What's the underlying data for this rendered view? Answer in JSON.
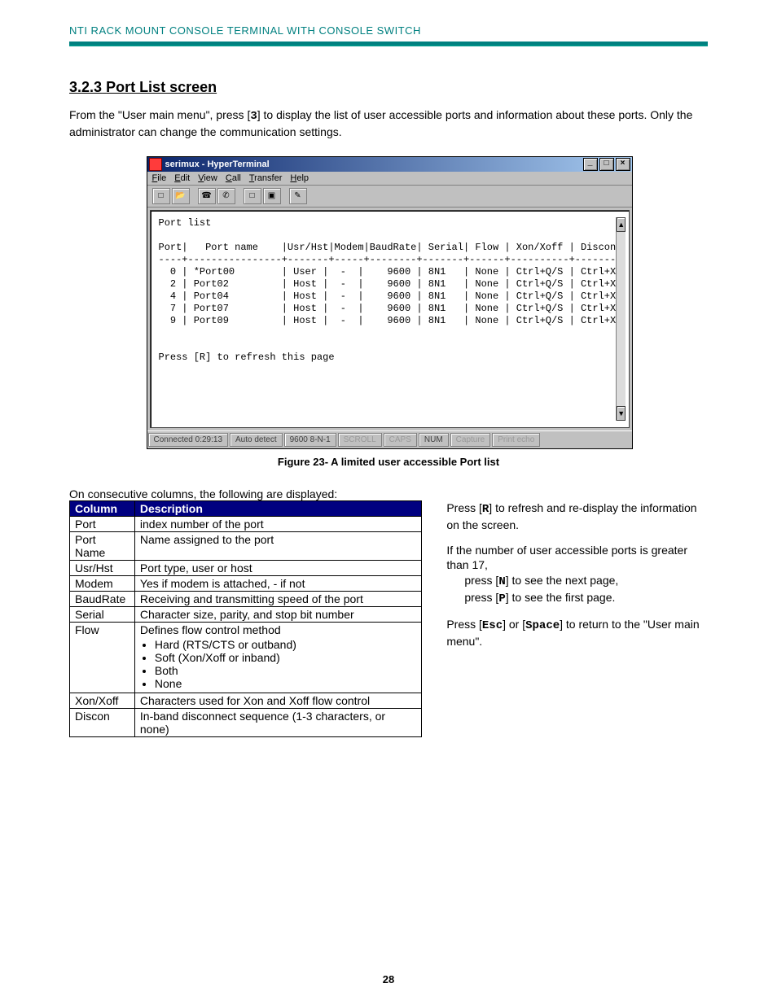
{
  "header": {
    "running": "NTI RACK MOUNT CONSOLE TERMINAL WITH CONSOLE SWITCH"
  },
  "section": {
    "number": "3.2.3",
    "title": "Port List screen"
  },
  "intro": {
    "pre": "From the \"User main menu\", press [",
    "key": "3",
    "post": "] to display the list of user accessible ports and information about these ports. Only the administrator can change the communication settings."
  },
  "hyperterm": {
    "title": "serimux - HyperTerminal",
    "menus": [
      "File",
      "Edit",
      "View",
      "Call",
      "Transfer",
      "Help"
    ],
    "status": {
      "connected": "Connected 0:29:13",
      "detect": "Auto detect",
      "mode": "9600 8-N-1",
      "cells": [
        "SCROLL",
        "CAPS",
        "NUM",
        "Capture",
        "Print echo"
      ]
    },
    "screen_title": "Port list",
    "columns_header": "Port|   Port name    |Usr/Hst|Modem|BaudRate| Serial| Flow | Xon/Xoff | Discon",
    "rows": [
      {
        "port": "0",
        "name": "*Port00",
        "usrhost": "User",
        "modem": "-",
        "baud": "9600",
        "serial": "8N1",
        "flow": "None",
        "xonxoff": "Ctrl+Q/S",
        "discon": "Ctrl+X"
      },
      {
        "port": "2",
        "name": "Port02",
        "usrhost": "Host",
        "modem": "-",
        "baud": "9600",
        "serial": "8N1",
        "flow": "None",
        "xonxoff": "Ctrl+Q/S",
        "discon": "Ctrl+X"
      },
      {
        "port": "4",
        "name": "Port04",
        "usrhost": "Host",
        "modem": "-",
        "baud": "9600",
        "serial": "8N1",
        "flow": "None",
        "xonxoff": "Ctrl+Q/S",
        "discon": "Ctrl+X"
      },
      {
        "port": "7",
        "name": "Port07",
        "usrhost": "Host",
        "modem": "-",
        "baud": "9600",
        "serial": "8N1",
        "flow": "None",
        "xonxoff": "Ctrl+Q/S",
        "discon": "Ctrl+X"
      },
      {
        "port": "9",
        "name": "Port09",
        "usrhost": "Host",
        "modem": "-",
        "baud": "9600",
        "serial": "8N1",
        "flow": "None",
        "xonxoff": "Ctrl+Q/S",
        "discon": "Ctrl+X"
      }
    ],
    "refresh_hint": "Press [R] to refresh this page"
  },
  "figure_caption": "Figure 23- A limited user accessible Port list",
  "table_lead": "On consecutive columns, the following are displayed:",
  "desc_table": {
    "head_col": "Column",
    "head_desc": "Description",
    "rows": [
      {
        "col": "Port",
        "desc": "index number of the port"
      },
      {
        "col": "Port Name",
        "desc": "Name assigned to the port"
      },
      {
        "col": "Usr/Hst",
        "desc": "Port type, user or host"
      },
      {
        "col": "Modem",
        "desc": "Yes if modem is attached,  -  if not"
      },
      {
        "col": "BaudRate",
        "desc": "Receiving and transmitting speed of the port"
      },
      {
        "col": "Serial",
        "desc": "Character size,  parity, and stop bit number"
      }
    ],
    "flow_row": {
      "col": "Flow",
      "desc": "Defines flow control method",
      "items": [
        "Hard (RTS/CTS or outband)",
        "Soft (Xon/Xoff or inband)",
        "Both",
        "None"
      ]
    },
    "tail_rows": [
      {
        "col": "Xon/Xoff",
        "desc": "Characters used for Xon and Xoff flow control"
      },
      {
        "col": "Discon",
        "desc": "In-band disconnect sequence (1-3 characters, or none)"
      }
    ]
  },
  "side": {
    "p1_pre": "Press [",
    "p1_key": "R",
    "p1_post": "] to refresh and re-display the information on the screen.",
    "p2": "If the number of user accessible ports is greater than 17,",
    "p2a_pre": "press [",
    "p2a_key": "N",
    "p2a_post": "] to see the next page,",
    "p2b_pre": "press [",
    "p2b_key": "P",
    "p2b_post": "] to see the first page.",
    "p3_pre": "Press [",
    "p3_key1": "Esc",
    "p3_mid": "] or [",
    "p3_key2": "Space",
    "p3_post": "] to return to the \"User main menu\"."
  },
  "page_number": "28"
}
